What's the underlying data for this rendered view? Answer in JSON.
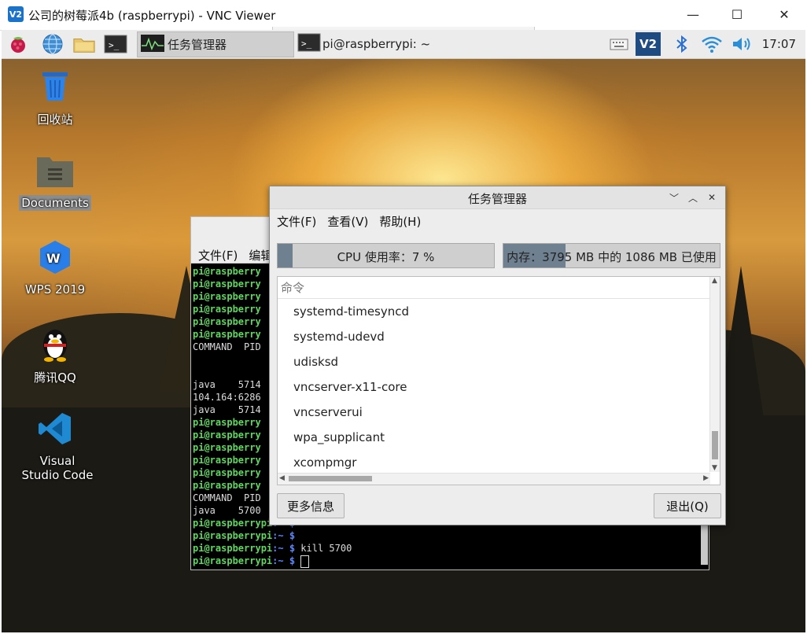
{
  "vnc": {
    "logo": "V2",
    "title": "公司的树莓派4b (raspberrypi) - VNC Viewer",
    "minimize": "—",
    "maximize": "☐",
    "close": "✕"
  },
  "panel": {
    "tasks": [
      {
        "label": "任务管理器",
        "active": true
      },
      {
        "label": "pi@raspberrypi: ~",
        "active": false
      }
    ],
    "clock": "17:07",
    "vnc_tray": "V2"
  },
  "desktop_icons": [
    {
      "label": "回收站",
      "icon": "trash-icon"
    },
    {
      "label": "Documents",
      "icon": "folder-icon"
    },
    {
      "label": "WPS 2019",
      "icon": "wps-icon"
    },
    {
      "label": "腾讯QQ",
      "icon": "qq-icon"
    },
    {
      "label": "Visual Studio Code",
      "icon": "vscode-icon"
    }
  ],
  "terminal": {
    "menu": [
      "文件(F)",
      "编辑"
    ],
    "prompt": "pi@raspberrypi",
    "lines": [
      {
        "t": "prompt",
        "text": "pi@raspberry"
      },
      {
        "t": "prompt",
        "text": "pi@raspberry"
      },
      {
        "t": "prompt",
        "text": "pi@raspberry"
      },
      {
        "t": "prompt",
        "text": "pi@raspberry"
      },
      {
        "t": "prompt",
        "text": "pi@raspberry"
      },
      {
        "t": "prompt",
        "text": "pi@raspberry"
      },
      {
        "t": "plain",
        "text": "COMMAND  PID"
      },
      {
        "t": "plain",
        "text": ""
      },
      {
        "t": "plain",
        "text": ""
      },
      {
        "t": "plain",
        "text": "java    5714"
      },
      {
        "t": "plain",
        "text": "104.164:6286"
      },
      {
        "t": "plain",
        "text": "java    5714"
      },
      {
        "t": "prompt",
        "text": "pi@raspberry"
      },
      {
        "t": "prompt",
        "text": "pi@raspberry"
      },
      {
        "t": "prompt",
        "text": "pi@raspberry"
      },
      {
        "t": "prompt",
        "text": "pi@raspberry"
      },
      {
        "t": "prompt",
        "text": "pi@raspberry"
      },
      {
        "t": "prompt",
        "text": "pi@raspberry"
      },
      {
        "t": "plain",
        "text": "COMMAND  PID"
      },
      {
        "t": "plain",
        "text": "java    5700"
      },
      {
        "t": "full",
        "text": "pi@raspberrypi:~ $"
      },
      {
        "t": "full",
        "text": "pi@raspberrypi:~ $"
      },
      {
        "t": "full",
        "text": "pi@raspberrypi:~ $ kill 5700"
      },
      {
        "t": "cursor",
        "text": "pi@raspberrypi:~ $ "
      }
    ]
  },
  "taskmgr": {
    "title": "任务管理器",
    "menu": [
      "文件(F)",
      "查看(V)",
      "帮助(H)"
    ],
    "cpu": {
      "label": "CPU 使用率：7 %",
      "fraction": 0.07
    },
    "mem": {
      "label": "内存：3795 MB 中的 1086 MB 已使用",
      "fraction": 0.286
    },
    "column_header": "命令",
    "processes": [
      "systemd-timesyncd",
      "systemd-udevd",
      "udisksd",
      "vncserver-x11-core",
      "vncserverui",
      "wpa_supplicant",
      "xcompmgr"
    ],
    "more_info": "更多信息",
    "quit": "退出(Q)"
  }
}
